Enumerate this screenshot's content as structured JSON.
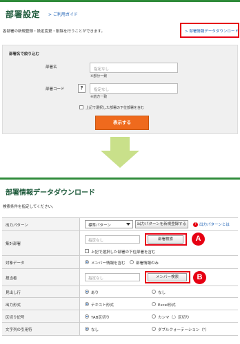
{
  "top": {
    "title": "部署設定",
    "guide_link": "> ご利用ガイド",
    "description": "各部署の新規登録・設定変更・削除を行うことができます。",
    "download_link": "> 部署情報データダウンロード",
    "filter": {
      "heading": "部署名で絞り込む",
      "name_label": "部署名",
      "name_placeholder": "指定なし",
      "name_note": "※部分一致",
      "code_label": "部署コード",
      "code_help": "?",
      "code_placeholder": "指定なし",
      "code_note": "※前方一致",
      "include_sub_label": "上記で選択した部署の下位部署を含む",
      "display_button": "表示する"
    }
  },
  "download": {
    "title": "部署情報データダウンロード",
    "description": "検索条件を指定してください。",
    "rows": {
      "output_pattern": {
        "label": "出力パターン",
        "select_value": "標準パターン",
        "register_button": "出力パターンを新規登録する",
        "help_link": "出力パターンとは",
        "help_icon": "?"
      },
      "aggregate_dept": {
        "label": "集計部署",
        "placeholder": "指定なし",
        "search_button": "部署検索",
        "include_sub_label": "上記で選択した部署の下位部署を含む",
        "marker": "A"
      },
      "target_data": {
        "label": "対象データ",
        "option1": "メンバー情報を含む",
        "option2": "部署情報のみ"
      },
      "person": {
        "label": "担当者",
        "placeholder": "指定なし",
        "search_button": "メンバー検索",
        "marker": "B"
      },
      "header_row": {
        "label": "見出し行",
        "option1": "あり",
        "option2": "なし"
      },
      "output_format": {
        "label": "出力形式",
        "option1": "テキスト形式",
        "option2": "Excel形式"
      },
      "delimiter": {
        "label": "区切り記号",
        "option1": "TAB区切り",
        "option2": "カンマ（,）区切り"
      },
      "quote": {
        "label": "文字列の引用符",
        "option1": "なし",
        "option2": "ダブルクォーテーション（\"）"
      }
    }
  },
  "colors": {
    "brand_green": "#2e8b3a",
    "title_green": "#1f5b3c",
    "accent_orange": "#ef6a1d",
    "highlight_red": "#e60012",
    "link_blue": "#1a5fb4"
  }
}
